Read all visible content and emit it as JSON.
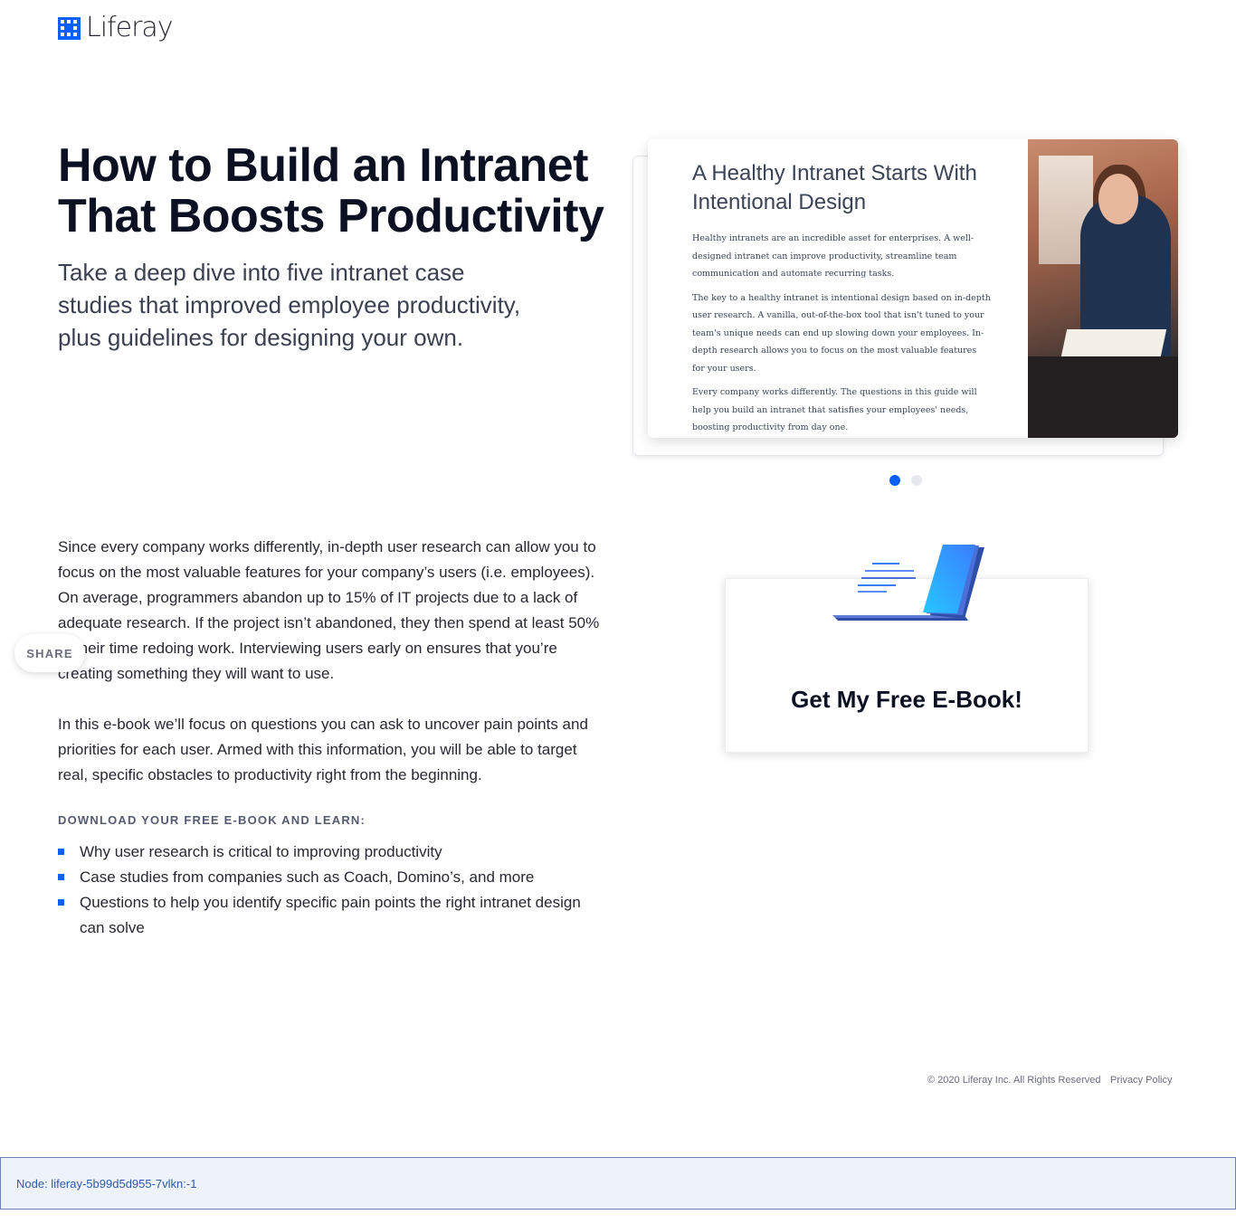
{
  "brand": {
    "name": "Liferay",
    "accent": "#0b5fff"
  },
  "hero": {
    "title": "How to Build an Intranet That Boosts Productivity",
    "subtitle": "Take a deep dive into five intranet case studies that improved employee productivity, plus guidelines for designing your own."
  },
  "carousel": {
    "slide": {
      "heading": "A Healthy Intranet Starts With Intentional Design",
      "paragraphs": [
        "Healthy intranets are an incredible asset for enterprises. A well-designed intranet can improve productivity, streamline team communication and automate recurring tasks.",
        "The key to a healthy intranet is intentional design based on in-depth user research. A vanilla, out-of-the-box tool that isn't tuned to your team's unique needs can end up slowing down your employees. In-depth research allows you to focus on the most valuable features for your users.",
        "Every company works differently. The questions in this guide will help you build an intranet that satisfies your employees' needs, boosting productivity from day one."
      ]
    },
    "active_index": 1,
    "total": 2
  },
  "body": {
    "paragraphs": [
      "Since every company works differently, in-depth user research can allow you to focus on the most valuable features for your company’s users (i.e. employees). On average, programmers abandon up to 15% of IT projects due to a lack of adequate research. If the project isn’t abandoned, they then spend at least 50% of their time redoing work. Interviewing users early on ensures that you’re creating something they will want to use.",
      "In this e-book we’ll focus on questions you can ask to uncover pain points and priorities for each user. Armed with this information, you will be able to target real, specific obstacles to productivity right from the beginning."
    ],
    "learn_heading": "DOWNLOAD YOUR FREE E-BOOK AND LEARN:",
    "bullets": [
      "Why user research is critical to improving productivity",
      "Case studies from companies such as Coach, Domino’s, and more",
      "Questions to help you identify specific pain points the right intranet design can solve"
    ]
  },
  "share": {
    "label": "SHARE"
  },
  "cta": {
    "title": "Get My Free E-Book!"
  },
  "footer": {
    "copyright": "© 2020 Liferay Inc. All Rights Reserved",
    "privacy": "Privacy Policy"
  },
  "node_bar": {
    "text": "Node: liferay-5b99d5d955-7vlkn:-1"
  }
}
